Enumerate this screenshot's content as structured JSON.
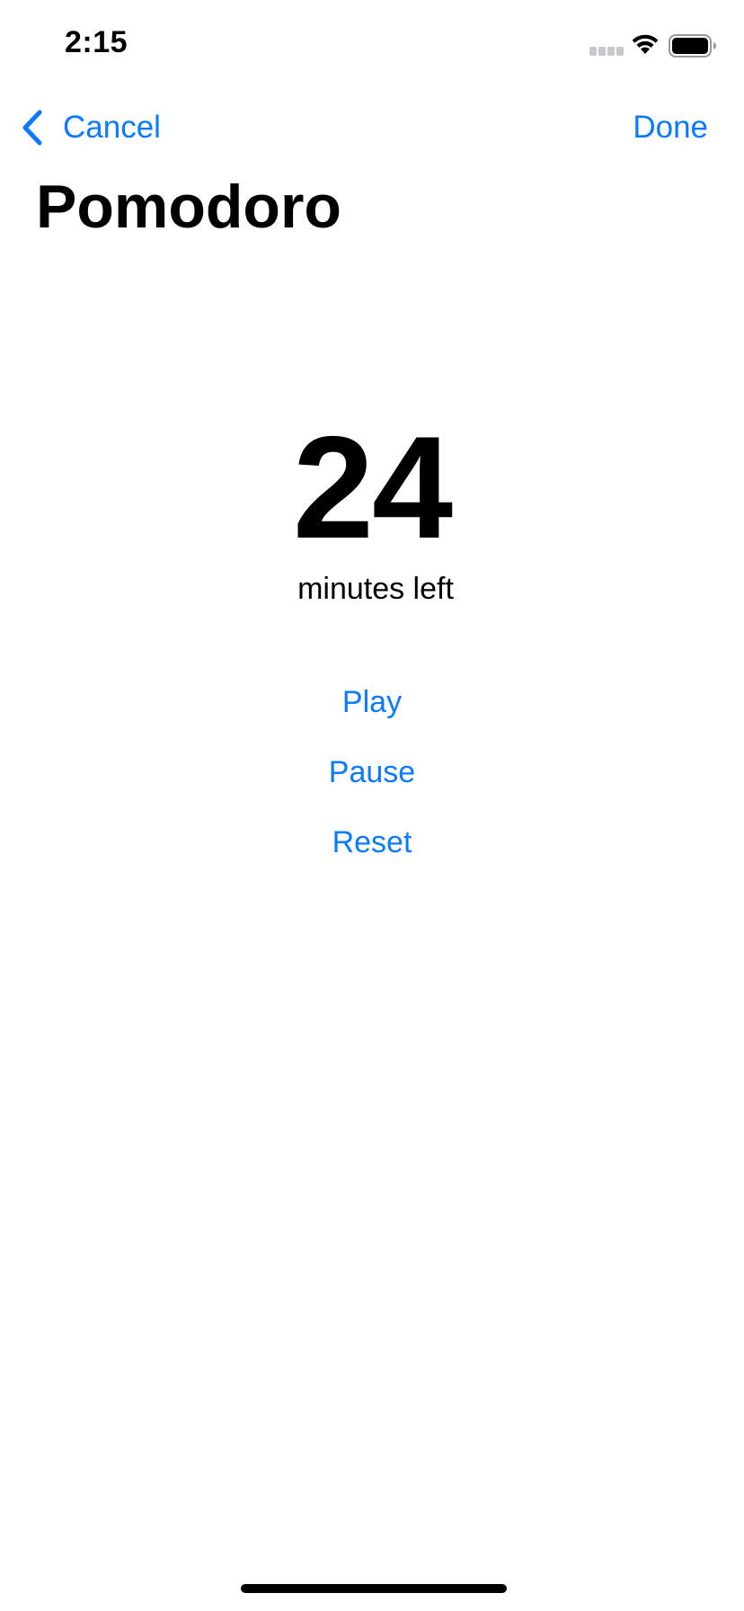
{
  "status_bar": {
    "time": "2:15",
    "icons": [
      "cellular-signal-icon",
      "wifi-icon",
      "battery-icon"
    ]
  },
  "nav": {
    "back_icon": "chevron-left-icon",
    "cancel_label": "Cancel",
    "done_label": "Done"
  },
  "title": "Pomodoro",
  "timer": {
    "value": "24",
    "caption": "minutes left"
  },
  "actions": {
    "play_label": "Play",
    "pause_label": "Pause",
    "reset_label": "Reset"
  },
  "colors": {
    "accent": "#0A7BFF",
    "text": "#000000",
    "background": "#FFFFFF"
  }
}
